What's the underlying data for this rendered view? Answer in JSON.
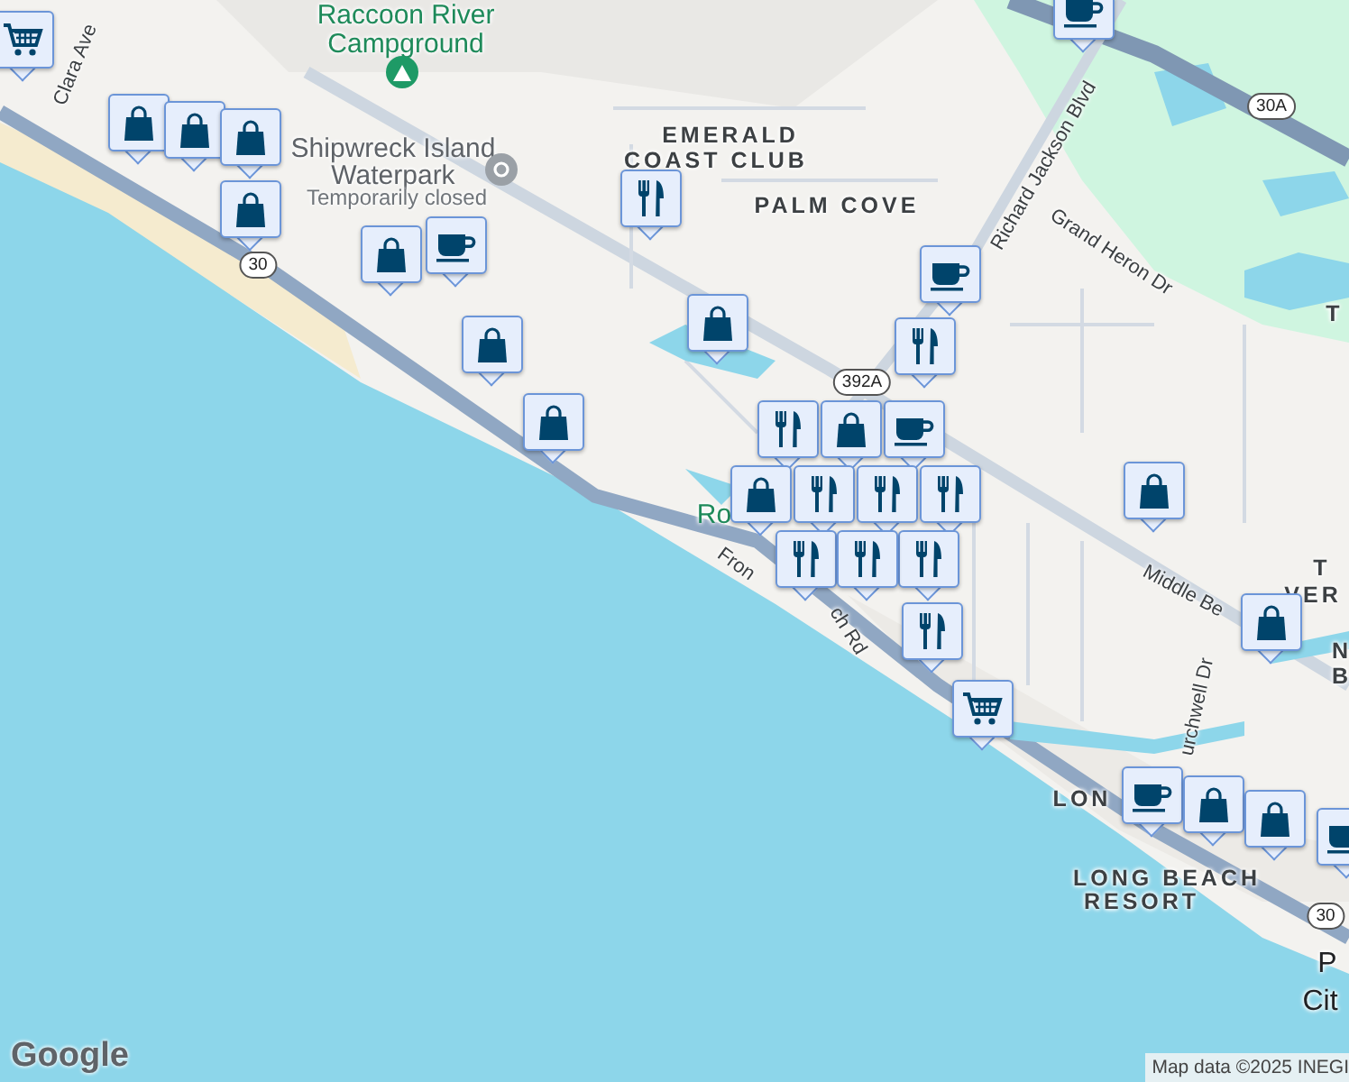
{
  "map": {
    "labels": [
      {
        "text": "Raccoon River",
        "kind": "place"
      },
      {
        "text": "Campground",
        "kind": "place"
      },
      {
        "text": "Shipwreck Island",
        "kind": "poi"
      },
      {
        "text": "Waterpark",
        "kind": "poi"
      },
      {
        "text": "Temporarily closed",
        "kind": "note"
      },
      {
        "text": "Clara Ave",
        "kind": "road"
      },
      {
        "text": "EMERALD",
        "kind": "area"
      },
      {
        "text": "COAST CLUB",
        "kind": "area"
      },
      {
        "text": "PALM COVE",
        "kind": "area"
      },
      {
        "text": "Richard Jackson Blvd",
        "kind": "road"
      },
      {
        "text": "Grand Heron Dr",
        "kind": "road"
      },
      {
        "text": "Ro",
        "kind": "place"
      },
      {
        "text": "Fron",
        "kind": "road"
      },
      {
        "text": "ch Rd",
        "kind": "road"
      },
      {
        "text": "Middle Be",
        "kind": "road"
      },
      {
        "text": "T",
        "kind": "area"
      },
      {
        "text": "T",
        "kind": "area"
      },
      {
        "text": "VER",
        "kind": "area"
      },
      {
        "text": "N",
        "kind": "area"
      },
      {
        "text": "B",
        "kind": "area"
      },
      {
        "text": "urchwell Dr",
        "kind": "road"
      },
      {
        "text": "LON",
        "kind": "area"
      },
      {
        "text": "LONG BEACH",
        "kind": "area"
      },
      {
        "text": "RESORT",
        "kind": "area"
      },
      {
        "text": "P",
        "kind": "city"
      },
      {
        "text": "Cit",
        "kind": "city"
      }
    ],
    "shields": [
      {
        "text": "30A"
      },
      {
        "text": "30"
      },
      {
        "text": "392A"
      },
      {
        "text": "30"
      }
    ],
    "markers": [
      {
        "kind": "cart"
      },
      {
        "kind": "shop"
      },
      {
        "kind": "shop"
      },
      {
        "kind": "shop"
      },
      {
        "kind": "shop"
      },
      {
        "kind": "coffee"
      },
      {
        "kind": "shop"
      },
      {
        "kind": "coffee"
      },
      {
        "kind": "food"
      },
      {
        "kind": "shop"
      },
      {
        "kind": "coffee"
      },
      {
        "kind": "food"
      },
      {
        "kind": "shop"
      },
      {
        "kind": "shop"
      },
      {
        "kind": "food"
      },
      {
        "kind": "coffee"
      },
      {
        "kind": "shop"
      },
      {
        "kind": "food"
      },
      {
        "kind": "food"
      },
      {
        "kind": "food"
      },
      {
        "kind": "shop"
      },
      {
        "kind": "food"
      },
      {
        "kind": "food"
      },
      {
        "kind": "food"
      },
      {
        "kind": "food"
      },
      {
        "kind": "shop"
      },
      {
        "kind": "shop"
      },
      {
        "kind": "cart"
      },
      {
        "kind": "coffee"
      },
      {
        "kind": "shop"
      },
      {
        "kind": "shop"
      },
      {
        "kind": "coffee"
      }
    ],
    "attribution": "Map data ©2025 INEGI",
    "logo": "Google"
  }
}
